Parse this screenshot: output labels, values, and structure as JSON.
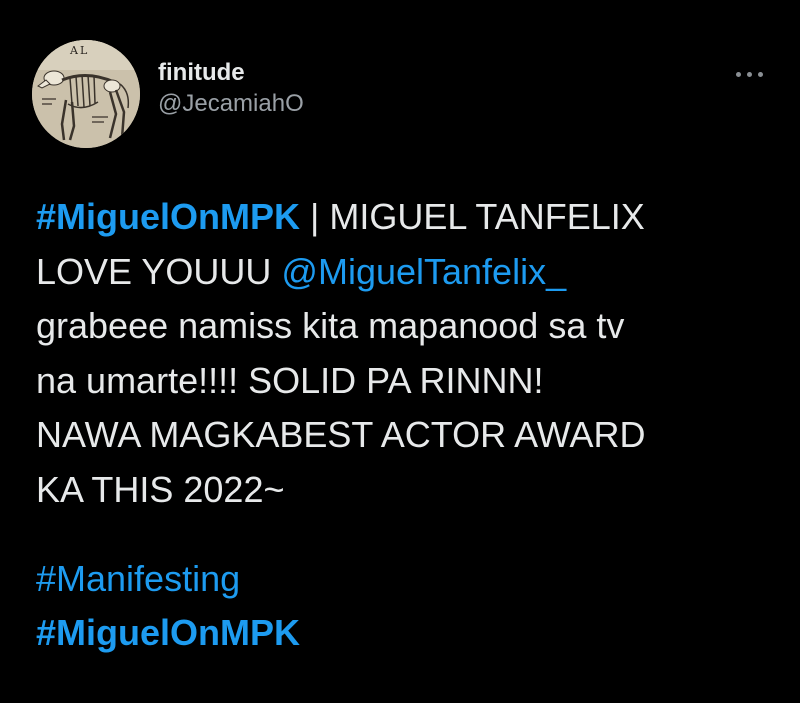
{
  "author": {
    "display_name": "finitude",
    "handle": "@JecamiahO",
    "avatar_icon": "skeleton-animal-avatar"
  },
  "menu": {
    "more_icon": "more-horizontal-icon"
  },
  "tweet": {
    "line1_hashtag": "#MiguelOnMPK",
    "line1_text": " | MIGUEL TANFELIX",
    "line2_text": "LOVE YOUUU ",
    "line2_mention": "@MiguelTanfelix_",
    "line3_text": "grabeee namiss kita mapanood sa tv",
    "line4_text": "na umarte!!!! SOLID PA RINNN!",
    "line5_text": "NAWA MAGKABEST ACTOR AWARD",
    "line6_text": "KA THIS 2022~",
    "hashtag_manifesting": "#Manifesting",
    "hashtag_miguel": "#MiguelOnMPK"
  },
  "colors": {
    "background": "#000000",
    "text": "#e7e9ea",
    "secondary": "#9aa0a6",
    "link": "#1d9bf0"
  }
}
